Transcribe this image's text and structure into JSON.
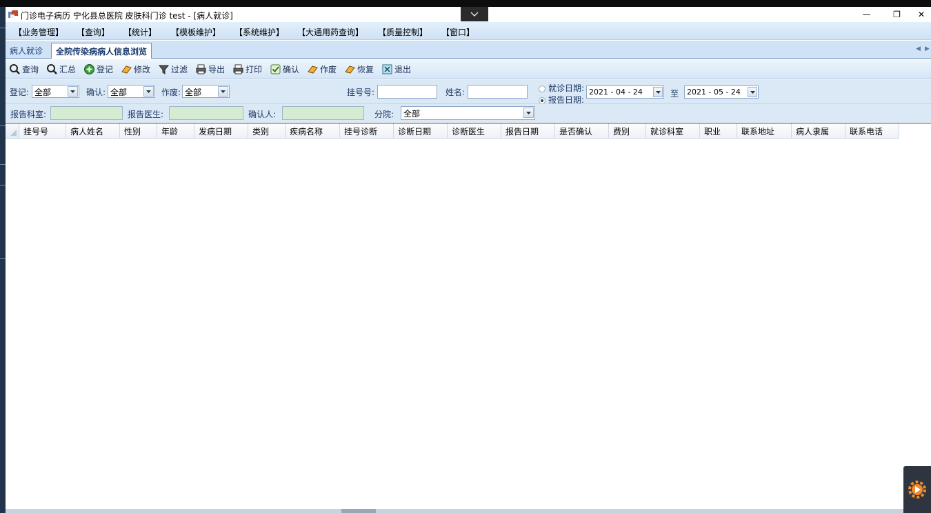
{
  "window": {
    "title": "门诊电子病历  宁化县总医院  皮肤科门诊  test - [病人就诊]",
    "controls": {
      "minimize": "—",
      "restore": "❐",
      "close": "✕"
    }
  },
  "menu": [
    "【业务管理】",
    "【查询】",
    "【统计】",
    "【模板维护】",
    "【系统维护】",
    "【大通用药查询】",
    "【质量控制】",
    "【窗口】"
  ],
  "tabs": [
    {
      "label": "病人就诊",
      "active": false
    },
    {
      "label": "全院传染病病人信息浏览",
      "active": true
    }
  ],
  "toolbar": [
    {
      "label": "查询",
      "icon": "magnifier-icon"
    },
    {
      "label": "汇总",
      "icon": "magnifier-icon"
    },
    {
      "label": "登记",
      "icon": "add-circle-icon"
    },
    {
      "label": "修改",
      "icon": "eraser-icon"
    },
    {
      "label": "过滤",
      "icon": "funnel-icon"
    },
    {
      "label": "导出",
      "icon": "printer-icon"
    },
    {
      "label": "打印",
      "icon": "printer-icon"
    },
    {
      "label": "确认",
      "icon": "check-icon"
    },
    {
      "label": "作废",
      "icon": "eraser-icon"
    },
    {
      "label": "恢复",
      "icon": "eraser-icon"
    },
    {
      "label": "退出",
      "icon": "exit-icon"
    }
  ],
  "filters": {
    "register_label": "登记:",
    "register_value": "全部",
    "confirm_label": "确认:",
    "confirm_value": "全部",
    "void_label": "作废:",
    "void_value": "全部",
    "reg_no_label": "挂号号:",
    "reg_no_value": "",
    "name_label": "姓名:",
    "name_value": "",
    "visit_date_label": "就诊日期:",
    "report_date_label": "报告日期:",
    "date_mode": "report",
    "date_from": "2021 - 04 - 24",
    "date_to_label": "至",
    "date_to": "2021 - 05 - 24",
    "report_dept_label": "报告科室:",
    "report_doctor_label": "报告医生:",
    "confirmer_label": "确认人:",
    "branch_label": "分院:",
    "branch_value": "全部"
  },
  "grid": {
    "columns": [
      "挂号号",
      "病人姓名",
      "性别",
      "年龄",
      "发病日期",
      "类别",
      "疾病名称",
      "挂号诊断",
      "诊断日期",
      "诊断医生",
      "报告日期",
      "是否确认",
      "费别",
      "就诊科室",
      "职业",
      "联系地址",
      "病人隶属",
      "联系电话"
    ],
    "rows": []
  },
  "colors": {
    "menubar": "#cfe2f6",
    "filter_bg": "#dbe8f6",
    "green_field": "#d6ecd2",
    "header_text": "#1f3a66"
  }
}
